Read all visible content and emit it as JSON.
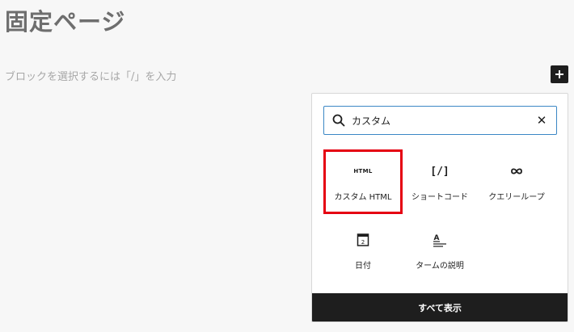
{
  "page": {
    "title": "固定ページ",
    "block_placeholder": "ブロックを選択するには「/」を入力"
  },
  "inserter": {
    "search": {
      "value": "カスタム",
      "icon": "search-icon",
      "clear_icon": "close-icon"
    },
    "blocks": [
      {
        "label": "カスタム HTML",
        "icon_text": "HTML",
        "icon": "html-icon",
        "highlighted": true
      },
      {
        "label": "ショートコード",
        "icon_text": "[/]",
        "icon": "shortcode-icon"
      },
      {
        "label": "クエリーループ",
        "icon": "loop-icon"
      },
      {
        "label": "日付",
        "icon": "calendar-icon",
        "icon_text": "2"
      },
      {
        "label": "タームの説明",
        "icon": "term-description-icon",
        "icon_text": "A"
      }
    ],
    "footer_label": "すべて表示"
  },
  "colors": {
    "accent": "#3b87c5",
    "highlight": "#e50012",
    "dark": "#1e1e1e"
  }
}
